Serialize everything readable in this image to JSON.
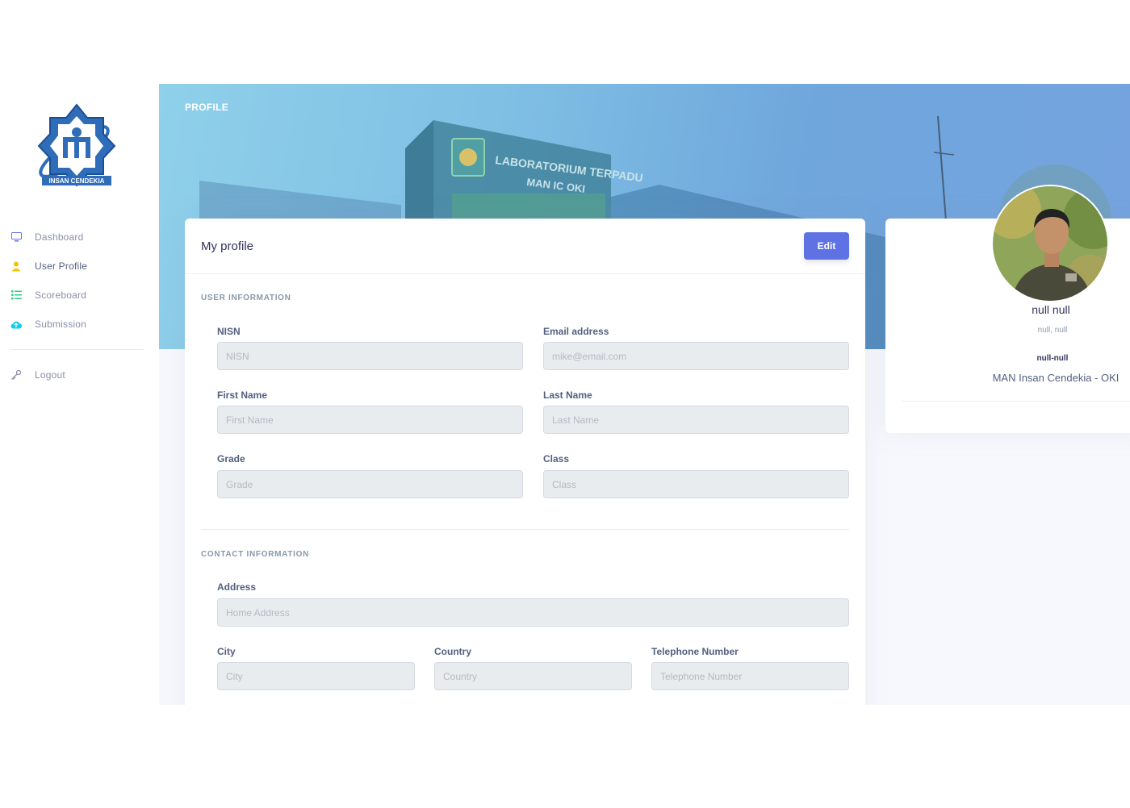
{
  "brand": {
    "logo_text": "INSAN CENDEKIA"
  },
  "sidebar": {
    "items": [
      {
        "label": "Dashboard",
        "icon": "monitor-icon",
        "color": "#5e72e4"
      },
      {
        "label": "User Profile",
        "icon": "user-icon",
        "color": "#f5c400"
      },
      {
        "label": "Scoreboard",
        "icon": "list-icon",
        "color": "#2dce89"
      },
      {
        "label": "Submission",
        "icon": "cloud-upload-icon",
        "color": "#11cdef"
      }
    ],
    "logout": {
      "label": "Logout",
      "icon": "key-icon"
    }
  },
  "header": {
    "title": "PROFILE",
    "banner_text_1": "LABORATORIUM TERPADU",
    "banner_text_2": "MAN IC OKI"
  },
  "profile_card": {
    "title": "My profile",
    "edit_label": "Edit",
    "user_section": "USER INFORMATION",
    "contact_section": "CONTACT INFORMATION",
    "fields": {
      "nisn": {
        "label": "NISN",
        "placeholder": "NISN"
      },
      "email": {
        "label": "Email address",
        "placeholder": "mike@email.com"
      },
      "first_name": {
        "label": "First Name",
        "placeholder": "First Name"
      },
      "last_name": {
        "label": "Last Name",
        "placeholder": "Last Name"
      },
      "grade": {
        "label": "Grade",
        "placeholder": "Grade"
      },
      "class": {
        "label": "Class",
        "placeholder": "Class"
      },
      "address": {
        "label": "Address",
        "placeholder": "Home Address"
      },
      "city": {
        "label": "City",
        "placeholder": "City"
      },
      "country": {
        "label": "Country",
        "placeholder": "Country"
      },
      "telephone": {
        "label": "Telephone Number",
        "placeholder": "Telephone Number"
      }
    }
  },
  "side_card": {
    "name": "null null",
    "subtitle": "null, null",
    "code": "null-null",
    "school": "MAN Insan Cendekia - OKI"
  }
}
